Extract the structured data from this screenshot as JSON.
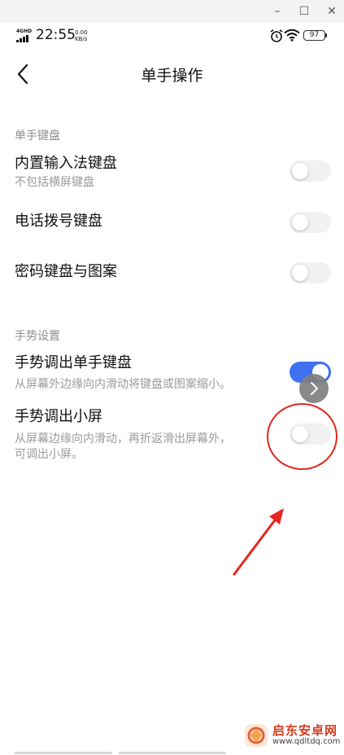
{
  "window": {
    "minimize_glyph": "–",
    "maximize_glyph": "☐",
    "close_glyph": "✕"
  },
  "status_bar": {
    "network_type": "4GHD",
    "time": "22:55",
    "speed_value": "0.00",
    "speed_unit": "KB/s",
    "battery": "97",
    "icons": [
      "signal-icon",
      "alarm-icon",
      "wifi-icon",
      "battery-icon"
    ]
  },
  "header": {
    "title": "单手操作",
    "back_icon": "chevron-left-icon"
  },
  "section_keyboard": {
    "header": "单手键盘",
    "items": [
      {
        "title": "内置输入法键盘",
        "subtitle": "不包括横屏键盘",
        "enabled": false
      },
      {
        "title": "电话拨号键盘",
        "enabled": false
      },
      {
        "title": "密码键盘与图案",
        "enabled": false
      }
    ]
  },
  "section_gesture": {
    "header": "手势设置",
    "items": [
      {
        "title": "手势调出单手键盘",
        "subtitle": "从屏幕外边缘向内滑动将键盘或图案缩小。",
        "enabled": true
      },
      {
        "title": "手势调出小屏",
        "subtitle_line1": "从屏幕边缘向内滑动，再折返滑出屏幕外，",
        "subtitle_line2": "可调出小屏。",
        "enabled": false
      }
    ]
  },
  "annotation": {
    "color": "#e52520"
  },
  "accent_color": "#3f71f0",
  "watermark": {
    "name": "启东安卓网",
    "url": "www.qdltdq.com"
  }
}
